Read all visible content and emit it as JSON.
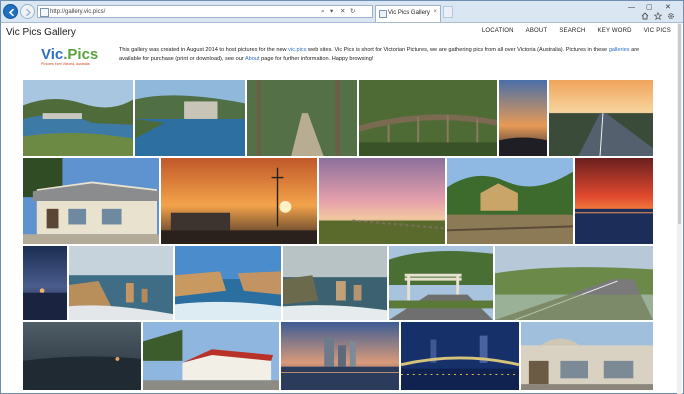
{
  "browser": {
    "url": "http://gallery.vic.pics/",
    "tab_title": "Vic Pics Gallery",
    "tab_close": "×",
    "address_controls": [
      "⌕",
      "▾",
      "✕",
      "↻"
    ],
    "window_controls": [
      "—",
      "▢",
      "✕"
    ],
    "toolbar_icons": [
      "home-icon",
      "star-icon",
      "gear-icon"
    ]
  },
  "site": {
    "title": "Vic Pics Gallery",
    "nav": [
      "LOCATION",
      "ABOUT",
      "SEARCH",
      "KEY WORD",
      "VIC PICS"
    ],
    "logo": {
      "text_vic": "Vic",
      "text_pics": ".Pics",
      "tagline": "Pictures from Victoria, Australia"
    },
    "intro": {
      "t1": "This gallery was created in August 2014 to host pictures for the new ",
      "l1": "vic.pics",
      "t2": " web sites.  Vic Pics is short for Victorian Pictures, we are gathering pics from all over Victoria (Australia).  Pictures in these ",
      "l2": "galleries",
      "t3": " are available for purchase (print or download), see our ",
      "l3": "About",
      "t4": " page for further information.  Happy browsing!"
    }
  },
  "colors": {
    "accent_link": "#2a6fc7",
    "chrome_bg": "#dbe6f3"
  },
  "photos": [
    {
      "row": 1,
      "subject": "dam and reservoir in the hills"
    },
    {
      "row": 1,
      "subject": "dam wall and lake"
    },
    {
      "row": 1,
      "subject": "forest road with tall gum trees"
    },
    {
      "row": 1,
      "subject": "old wooden bridge in bushland"
    },
    {
      "row": 1,
      "subject": "sunset sky with silhouettes"
    },
    {
      "row": 1,
      "subject": "highway at dusk"
    },
    {
      "row": 2,
      "subject": "old country general store"
    },
    {
      "row": 2,
      "subject": "orange sunset over town"
    },
    {
      "row": 2,
      "subject": "pink sunset over fields"
    },
    {
      "row": 2,
      "subject": "old cottage by railway"
    },
    {
      "row": 2,
      "subject": "red sunset over water"
    },
    {
      "row": 3,
      "subject": "moonrise over sea"
    },
    {
      "row": 3,
      "subject": "Twelve Apostles coastline"
    },
    {
      "row": 3,
      "subject": "London Arch rock formation"
    },
    {
      "row": 3,
      "subject": "coastal rock stacks"
    },
    {
      "row": 3,
      "subject": "memorial arch by road"
    },
    {
      "row": 3,
      "subject": "winding country road"
    },
    {
      "row": 4,
      "subject": "coastline at dusk"
    },
    {
      "row": 4,
      "subject": "red roofed building"
    },
    {
      "row": 4,
      "subject": "city skyline at blue hour"
    },
    {
      "row": 4,
      "subject": "city bridge at night"
    },
    {
      "row": 4,
      "subject": "heritage shopfront"
    }
  ]
}
